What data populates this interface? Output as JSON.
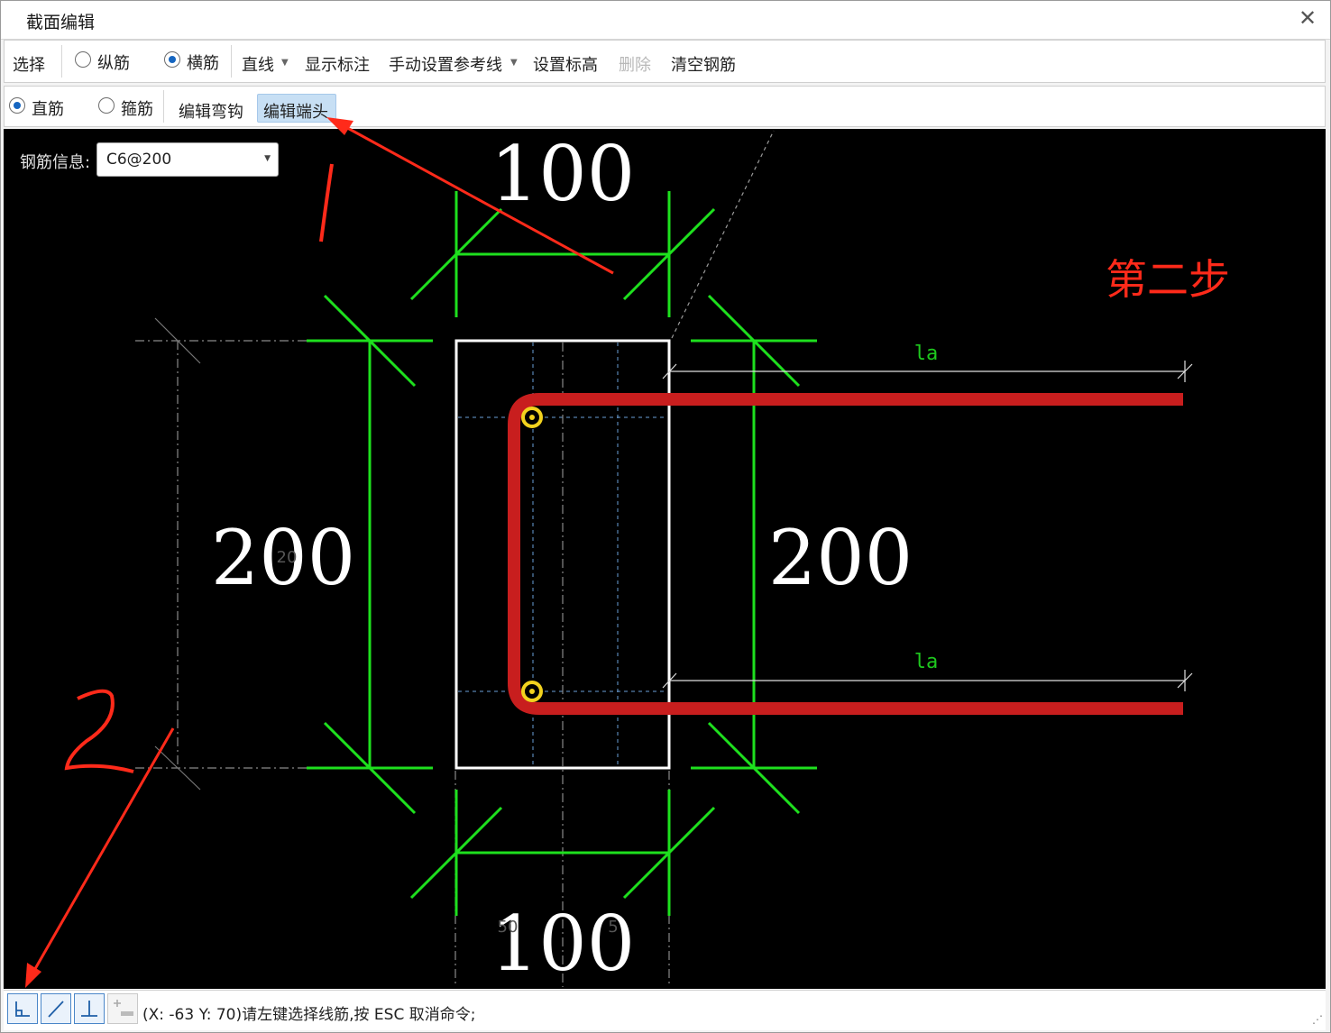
{
  "window": {
    "title": "截面编辑",
    "close_icon": "close-icon"
  },
  "toolbar1": {
    "select": "选择",
    "radio_longitudinal": "纵筋",
    "radio_transverse": "横筋",
    "transverse_selected": true,
    "line_dropdown": "直线",
    "show_annotation": "显示标注",
    "manual_ref_line": "手动设置参考线",
    "set_elevation": "设置标高",
    "delete": "删除",
    "clear_rebar": "清空钢筋"
  },
  "toolbar2": {
    "radio_straight": "直筋",
    "radio_stirrup": "箍筋",
    "straight_selected": true,
    "edit_hook": "编辑弯钩",
    "edit_end": "编辑端头"
  },
  "rebar_info": {
    "label": "钢筋信息:",
    "value": "C6@200"
  },
  "drawing": {
    "dim_top": "100",
    "dim_bottom": "100",
    "dim_left": "200",
    "dim_right": "200",
    "la_top": "la",
    "la_bottom": "la",
    "faint_left": "20",
    "faint_bottom_a": "50",
    "faint_bottom_b": "5",
    "annotation_step": "第二步",
    "colors": {
      "dim": "#1ee01e",
      "rebar": "#c81e1e",
      "outline": "#ffffff",
      "la": "#1ec81e",
      "annotation": "#ff2a1a",
      "point": "#f2d21e"
    }
  },
  "statusbar": {
    "tool_icons": [
      "ortho-snap-icon",
      "line-snap-icon",
      "perpendicular-icon",
      "add-point-icon"
    ],
    "message": "(X: -63 Y: 70)请左键选择线筋,按 ESC 取消命令;"
  }
}
